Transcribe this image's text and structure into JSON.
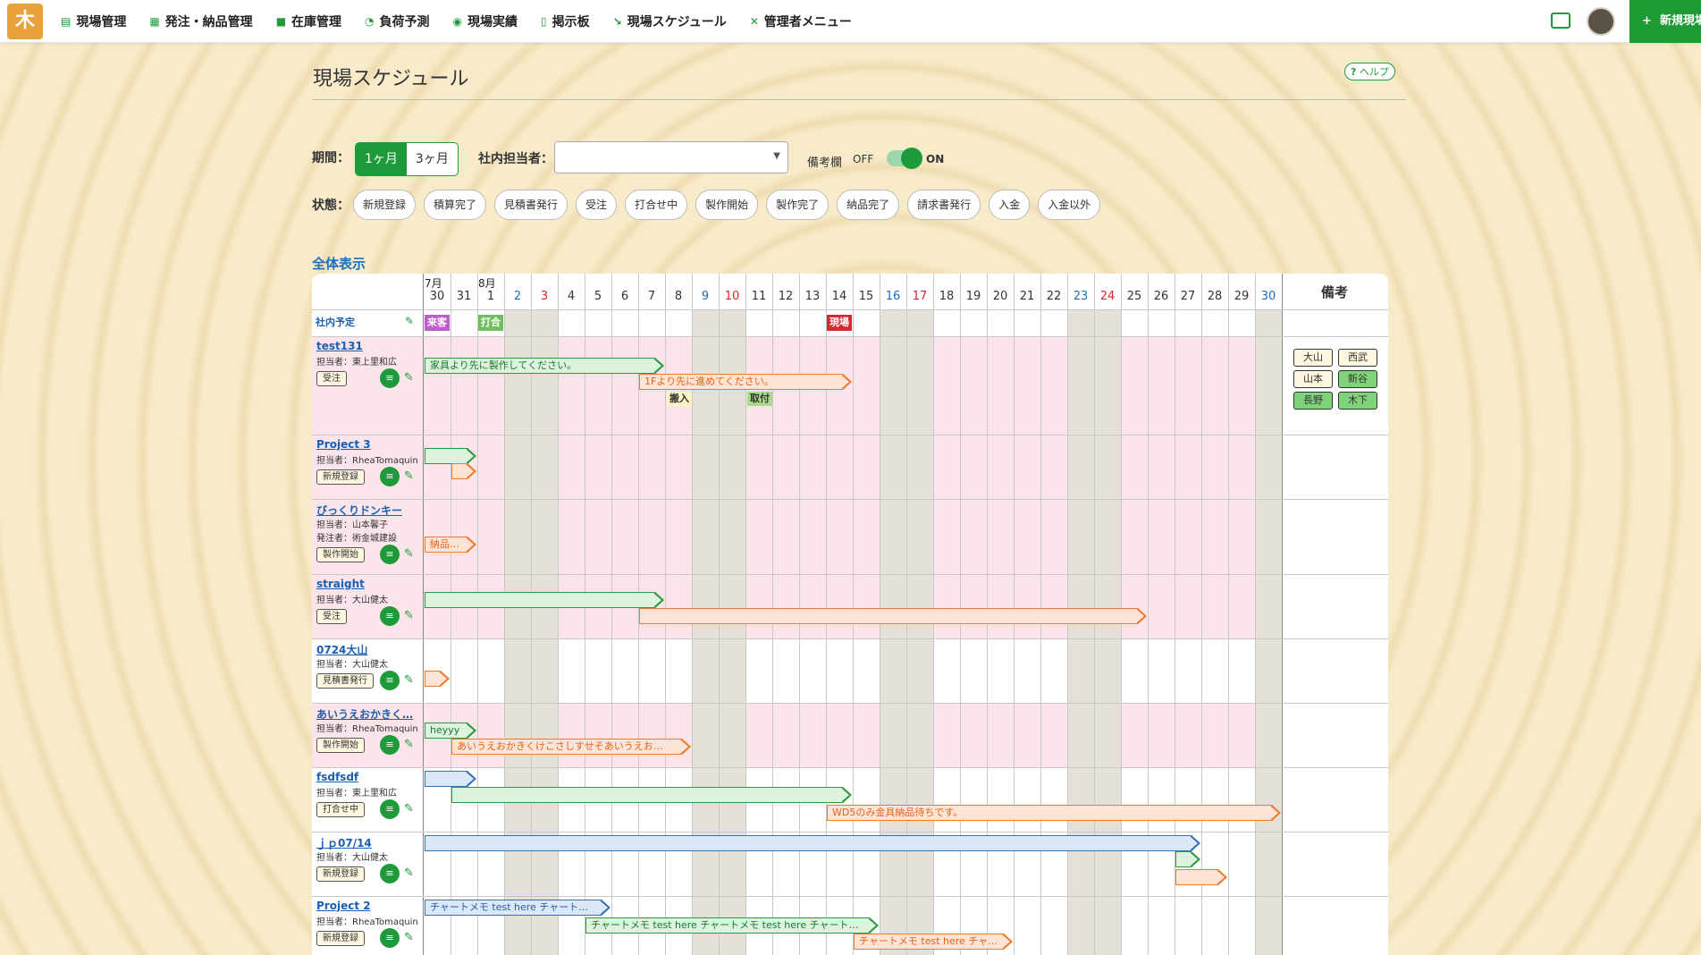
{
  "app": {
    "logo": "木"
  },
  "nav": [
    {
      "icon": "clipboard-icon",
      "label": "現場管理"
    },
    {
      "icon": "boxes-icon",
      "label": "発注・納品管理"
    },
    {
      "icon": "inventory-icon",
      "label": "在庫管理"
    },
    {
      "icon": "gauge-icon",
      "label": "負荷予測"
    },
    {
      "icon": "chart-icon",
      "label": "現場実績"
    },
    {
      "icon": "board-icon",
      "label": "掲示板"
    },
    {
      "icon": "schedule-icon",
      "label": "現場スケジュール"
    },
    {
      "icon": "tools-icon",
      "label": "管理者メニュー"
    }
  ],
  "header": {
    "new_button": "新規現場",
    "new_plus": "+"
  },
  "page": {
    "title": "現場スケジュール",
    "help": "ヘルプ",
    "help_mark": "?",
    "all_view": "全体表示"
  },
  "filters": {
    "period_label": "期間：",
    "period_options": [
      "1ヶ月",
      "3ヶ月"
    ],
    "staff_label": "社内担当者：",
    "staff_value": "",
    "remarks_label": "備考欄",
    "off": "OFF",
    "on": "ON",
    "status_label": "状態：",
    "statuses": [
      "新規登録",
      "積算完了",
      "見積書発行",
      "受注",
      "打合せ中",
      "製作開始",
      "製作完了",
      "納品完了",
      "請求書発行",
      "入金",
      "入金以外"
    ]
  },
  "calendar": {
    "months": [
      "7月",
      "8月"
    ],
    "days": [
      "30",
      "31",
      "1",
      "2",
      "3",
      "4",
      "5",
      "6",
      "7",
      "8",
      "9",
      "10",
      "11",
      "12",
      "13",
      "14",
      "15",
      "16",
      "17",
      "18",
      "19",
      "20",
      "21",
      "22",
      "23",
      "24",
      "25",
      "26",
      "27",
      "28",
      "29",
      "30"
    ],
    "remarks_header": "備考",
    "company_row": "社内予定",
    "company_tags": [
      {
        "label": "来客",
        "color": "#c05bd0"
      },
      {
        "label": "打合",
        "color": "#6fc05a"
      },
      {
        "label": "現場",
        "color": "#d9272e"
      }
    ]
  },
  "rows": [
    {
      "name": "test131",
      "sub": [
        "担当者：東上里和広"
      ],
      "badge": "受注",
      "bars": [
        {
          "text": "家具より先に製作してください。",
          "color": "green"
        },
        {
          "text": "1Fより先に進めてください。",
          "color": "orange"
        }
      ],
      "steps": [
        "搬入",
        "取付"
      ]
    },
    {
      "name": "Project 3",
      "sub": [
        "担当者：RheaTomaquin"
      ],
      "badge": "新規登録",
      "bars": [
        {
          "text": "",
          "color": "green"
        },
        {
          "text": "",
          "color": "orange"
        }
      ]
    },
    {
      "name": "びっくりドンキー",
      "sub": [
        "担当者：山本馨子",
        "発注者：術金城建設"
      ],
      "badge": "製作開始",
      "bars": [
        {
          "text": "納品…",
          "color": "orange"
        }
      ]
    },
    {
      "name": "straight",
      "sub": [
        "担当者：大山健太"
      ],
      "badge": "受注",
      "bars": [
        {
          "text": "",
          "color": "green"
        },
        {
          "text": "",
          "color": "orange"
        }
      ]
    },
    {
      "name": "0724大山",
      "sub": [
        "担当者：大山健太"
      ],
      "badge": "見積書発行",
      "bars": [
        {
          "text": "",
          "color": "orange"
        }
      ]
    },
    {
      "name": "あいうえおかきく…",
      "sub": [
        "担当者：RheaTomaquin"
      ],
      "badge": "製作開始",
      "bars": [
        {
          "text": "heyyy",
          "color": "green"
        },
        {
          "text": "あいうえおかきくけこさしすせそあいうえお…",
          "color": "orange"
        }
      ]
    },
    {
      "name": "fsdfsdf",
      "sub": [
        "担当者：東上里和広"
      ],
      "badge": "打合せ中",
      "bars": [
        {
          "text": "",
          "color": "blue"
        },
        {
          "text": "",
          "color": "green"
        },
        {
          "text": "WD5のみ金具納品待ちです。",
          "color": "orange"
        }
      ]
    },
    {
      "name": "ｊｐ07/14",
      "sub": [
        "担当者：大山健太"
      ],
      "badge": "新規登録",
      "bars": [
        {
          "text": "",
          "color": "blue"
        },
        {
          "text": "",
          "color": "green"
        },
        {
          "text": "",
          "color": "orange"
        }
      ]
    },
    {
      "name": "Project 2",
      "sub": [
        "担当者：RheaTomaquin"
      ],
      "badge": "新規登録",
      "bars": [
        {
          "text": "チャートメモ test here チャート…",
          "color": "blue"
        },
        {
          "text": "チャートメモ test here チャートメモ test here チャート…",
          "color": "green"
        },
        {
          "text": "チャートメモ test here チャ…",
          "color": "orange"
        }
      ]
    }
  ],
  "remarks": [
    {
      "label": "大山",
      "color": "#fff7e0"
    },
    {
      "label": "西武",
      "color": "#fff7e0"
    },
    {
      "label": "山本",
      "color": "#fff7e0"
    },
    {
      "label": "新谷",
      "color": "#7fd37a"
    },
    {
      "label": "長野",
      "color": "#7fd37a"
    },
    {
      "label": "木下",
      "color": "#7fd37a"
    }
  ]
}
